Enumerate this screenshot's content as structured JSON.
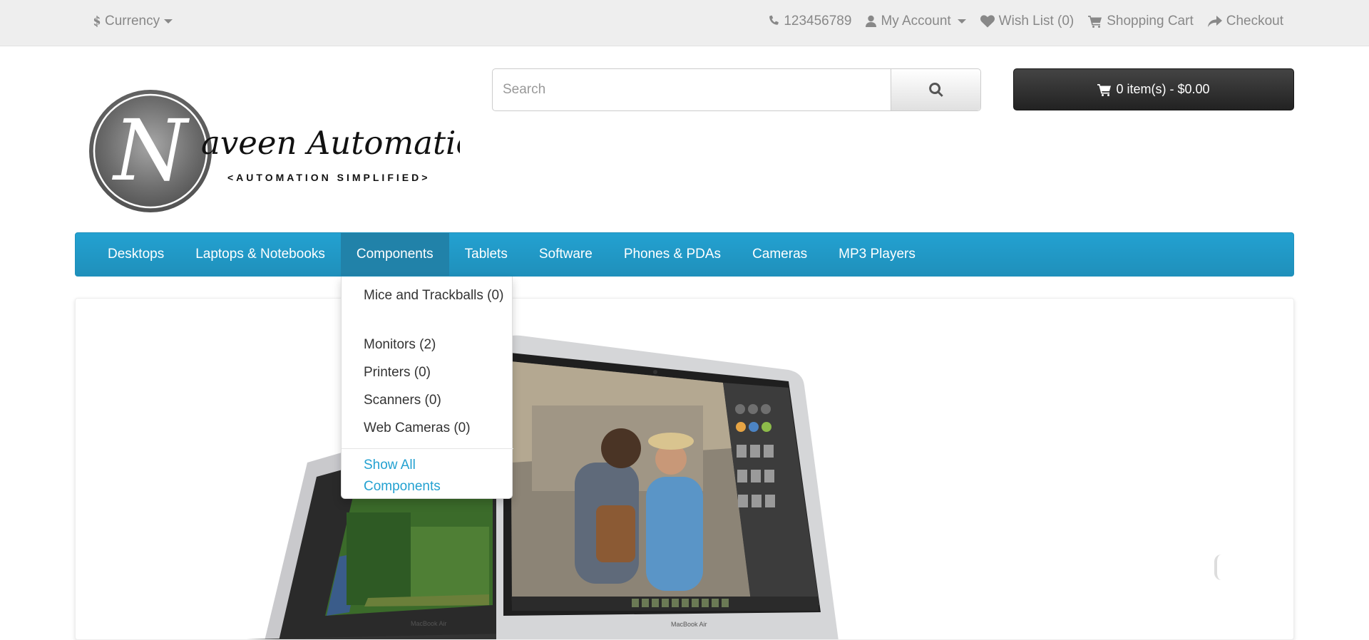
{
  "top_bar": {
    "currency_label": "Currency",
    "phone": "123456789",
    "my_account": "My Account",
    "wish_list": "Wish List (0)",
    "shopping_cart": "Shopping Cart",
    "checkout": "Checkout"
  },
  "logo": {
    "letter": "N",
    "name": "aveen Automation Labs",
    "tagline": "<AUTOMATION SIMPLIFIED>"
  },
  "search": {
    "placeholder": "Search"
  },
  "cart": {
    "label": "0 item(s) - $0.00"
  },
  "menu": {
    "items": [
      {
        "label": "Desktops"
      },
      {
        "label": "Laptops & Notebooks"
      },
      {
        "label": "Components"
      },
      {
        "label": "Tablets"
      },
      {
        "label": "Software"
      },
      {
        "label": "Phones & PDAs"
      },
      {
        "label": "Cameras"
      },
      {
        "label": "MP3 Players"
      }
    ],
    "active_index": 2
  },
  "dropdown": {
    "items": [
      {
        "label": "Mice and Trackballs (0)"
      },
      {
        "label": "Monitors (2)"
      },
      {
        "label": "Printers (0)"
      },
      {
        "label": "Scanners (0)"
      },
      {
        "label": "Web Cameras (0)"
      }
    ],
    "show_all": "Show All Components"
  },
  "slideshow": {
    "left_screen_caption": "MacBook Air",
    "right_screen_caption": "MacBook Air"
  },
  "colors": {
    "menu_blue": "#23a1d1",
    "menu_active": "#2182a9",
    "cart_dark": "#2a2a2a",
    "top_bar_bg": "#eeeeee",
    "link_blue": "#23a1d1"
  }
}
